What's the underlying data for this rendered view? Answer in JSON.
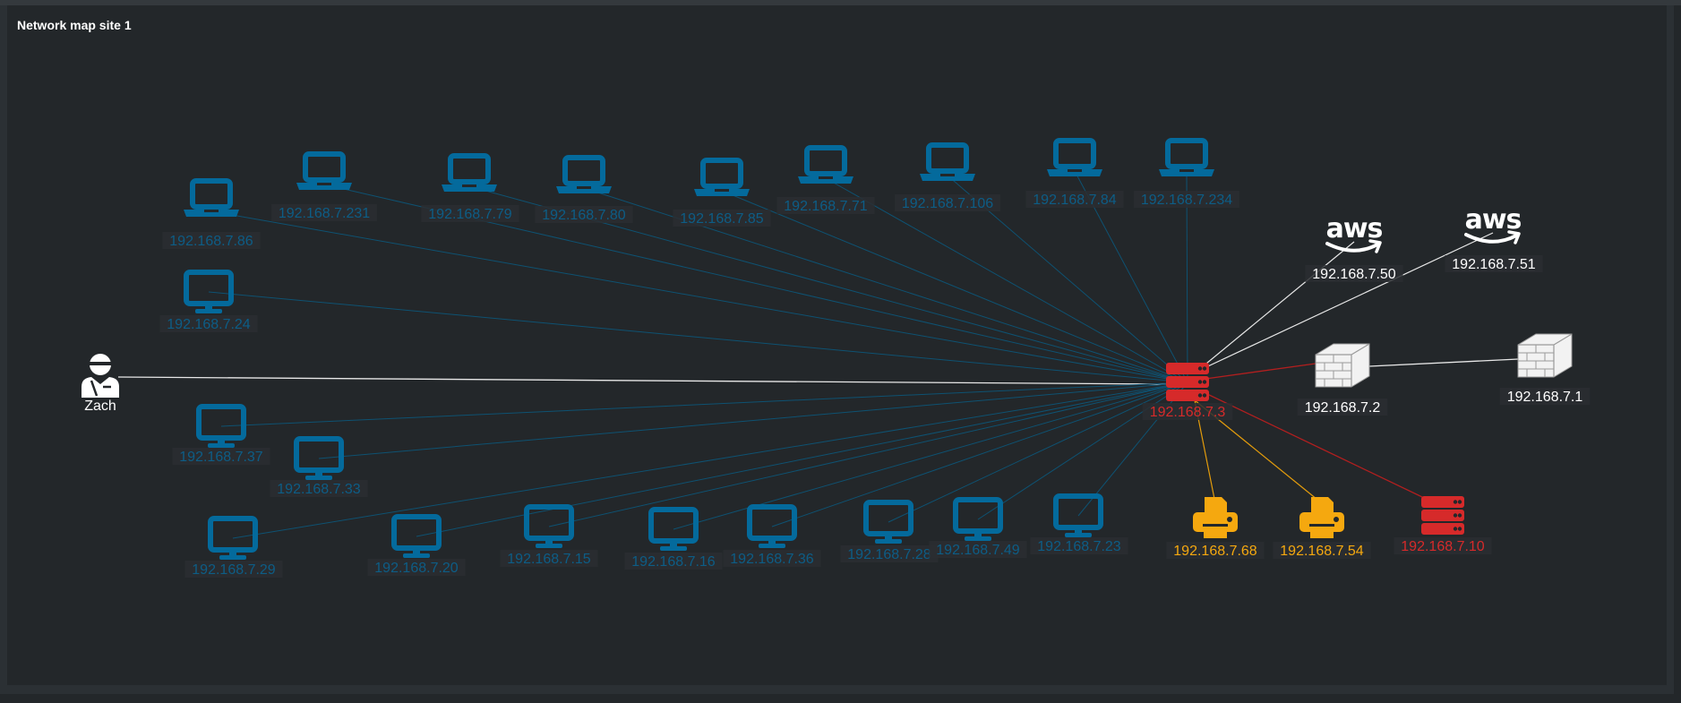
{
  "panel": {
    "title": "Network map site 1"
  },
  "colors": {
    "workstation": "#046a9c",
    "workstation_label": "#0d5d86",
    "white": "#ffffff",
    "printer": "#f5a80f",
    "server": "#d62a2a",
    "link_workstation": "#0e5272",
    "link_white": "#e8e8e8",
    "link_red": "#b21f1f",
    "link_orange": "#e39c0c"
  },
  "hub": {
    "label": "192.168.7.3",
    "kind": "server"
  },
  "user": {
    "label": "Zach",
    "kind": "user"
  },
  "laptops": [
    {
      "label": "192.168.7.86"
    },
    {
      "label": "192.168.7.231"
    },
    {
      "label": "192.168.7.79"
    },
    {
      "label": "192.168.7.80"
    },
    {
      "label": "192.168.7.85"
    },
    {
      "label": "192.168.7.71"
    },
    {
      "label": "192.168.7.106"
    },
    {
      "label": "192.168.7.84"
    },
    {
      "label": "192.168.7.234"
    }
  ],
  "desktops": [
    {
      "label": "192.168.7.24"
    },
    {
      "label": "192.168.7.37"
    },
    {
      "label": "192.168.7.33"
    },
    {
      "label": "192.168.7.29"
    },
    {
      "label": "192.168.7.20"
    },
    {
      "label": "192.168.7.15"
    },
    {
      "label": "192.168.7.16"
    },
    {
      "label": "192.168.7.36"
    },
    {
      "label": "192.168.7.28"
    },
    {
      "label": "192.168.7.49"
    },
    {
      "label": "192.168.7.23"
    }
  ],
  "cloud": [
    {
      "label": "192.168.7.50",
      "logo": "aws"
    },
    {
      "label": "192.168.7.51",
      "logo": "aws"
    }
  ],
  "firewalls": [
    {
      "label": "192.168.7.2"
    },
    {
      "label": "192.168.7.1"
    }
  ],
  "printers": [
    {
      "label": "192.168.7.68"
    },
    {
      "label": "192.168.7.54"
    }
  ],
  "servers": [
    {
      "label": "192.168.7.10"
    }
  ]
}
